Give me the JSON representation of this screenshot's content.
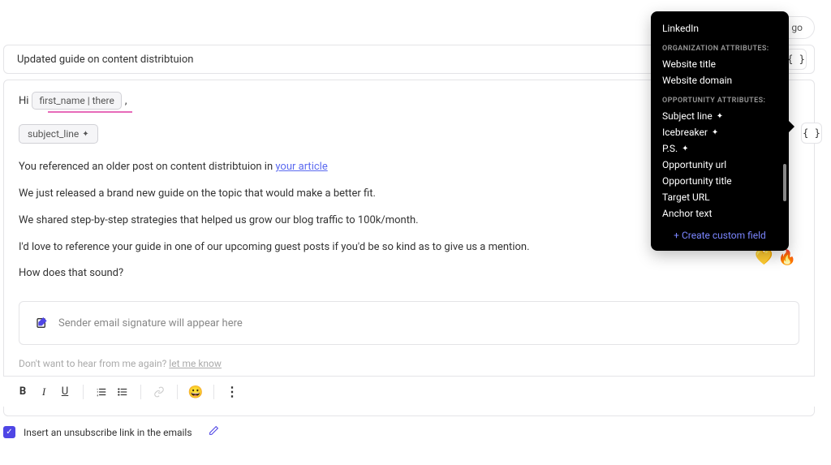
{
  "top": {
    "status": "d to go"
  },
  "subject": {
    "text": "Updated guide on content distribtuion"
  },
  "braces": "{ }",
  "greeting": {
    "prefix": "Hi",
    "token": "first_name | there",
    "suffix": ","
  },
  "chip": {
    "label": "subject_line"
  },
  "body": {
    "p1_a": "You referenced an older post on content distribtuion in ",
    "p1_link": "your article",
    "p2": "We just released a brand new guide on the topic that would make a better fit.",
    "p3": "We shared step-by-step strategies that helped us grow our blog traffic to 100k/month.",
    "p4": "I'd love to reference your guide in one of our upcoming guest posts if you'd be so kind as to give us a mention.",
    "p5": "How does that sound?"
  },
  "signature": {
    "placeholder": "Sender email signature will appear here"
  },
  "unsub": {
    "pre": "Don't want to hear from me again? ",
    "link": "let me know"
  },
  "tooltip": {
    "top_item": "LinkedIn",
    "org_head": "ORGANIZATION ATTRIBUTES:",
    "org_items": [
      "Website title",
      "Website domain"
    ],
    "opp_head": "OPPORTUNITY ATTRIBUTES:",
    "opp_items": [
      "Subject line",
      "Icebreaker",
      "P.S.",
      "Opportunity url",
      "Opportunity title",
      "Target URL",
      "Anchor text"
    ],
    "opp_spark": [
      true,
      true,
      true,
      false,
      false,
      false,
      false
    ],
    "create": "+ Create custom field"
  },
  "toolbar": {
    "bold": "B",
    "italic": "I",
    "underline": "U",
    "ol": "≡",
    "ul": "≡",
    "emoji": "😀",
    "more": "⋮"
  },
  "footer": {
    "label": "Insert an unsubscribe link in the emails"
  }
}
